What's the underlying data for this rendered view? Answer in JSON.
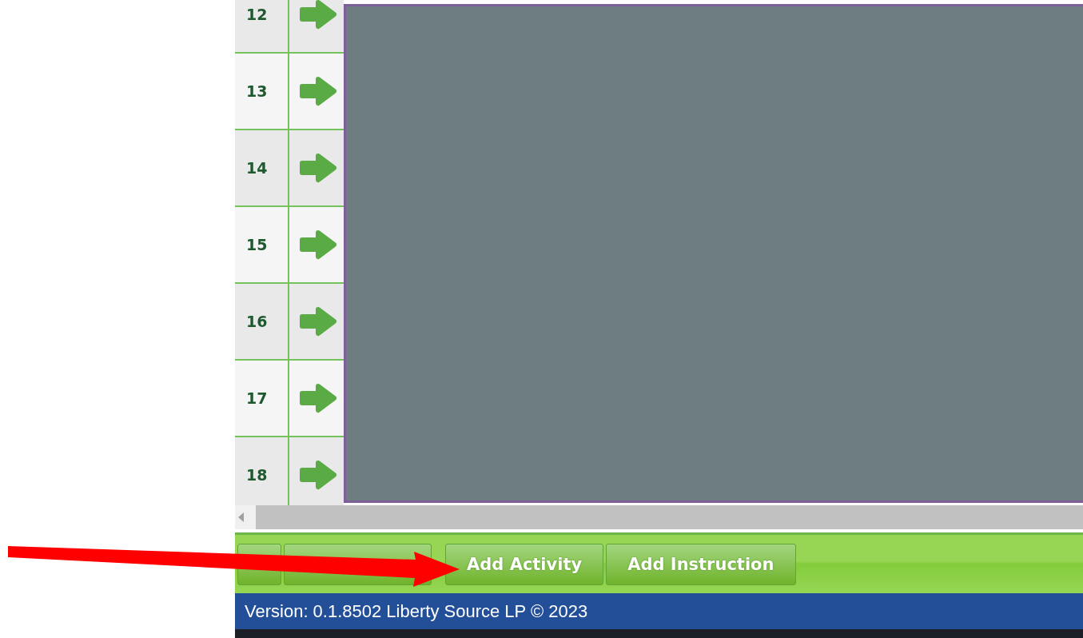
{
  "grid": {
    "rows": [
      {
        "number": "12"
      },
      {
        "number": "13"
      },
      {
        "number": "14"
      },
      {
        "number": "15"
      },
      {
        "number": "16"
      },
      {
        "number": "17"
      },
      {
        "number": "18"
      }
    ]
  },
  "toolbar": {
    "buttons": [
      {
        "kind": "narrow"
      },
      {
        "kind": "wide"
      },
      {
        "kind": "text",
        "label": "Add Activity"
      },
      {
        "kind": "text",
        "label": "Add Instruction"
      }
    ]
  },
  "footer": {
    "version": "Version: 0.1.8502 Liberty Source LP © 2023"
  },
  "annotation": {
    "kind": "arrow"
  }
}
